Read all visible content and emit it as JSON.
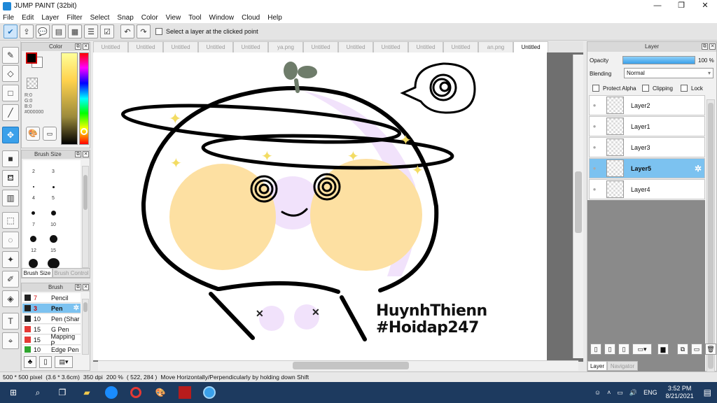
{
  "window": {
    "title": "JUMP PAINT (32bit)"
  },
  "menu": [
    "File",
    "Edit",
    "Layer",
    "Filter",
    "Select",
    "Snap",
    "Color",
    "View",
    "Tool",
    "Window",
    "Cloud",
    "Help"
  ],
  "toolbar": {
    "select_layer_label": "Select a layer at the clicked point"
  },
  "tabs": [
    "Untitled",
    "Untitled",
    "Untitled",
    "Untitled",
    "Untitled",
    "ya.png",
    "Untitled",
    "Untitled",
    "Untitled",
    "Untitled",
    "Untitled",
    "an.png",
    "Untitled"
  ],
  "color_panel": {
    "title": "Color",
    "r": "R:0",
    "g": "G:0",
    "b": "B:0",
    "hex": "#000000",
    "main_color": "#000000",
    "sub_color": "#ffffff"
  },
  "brush_size_panel": {
    "title": "Brush Size",
    "labels": [
      "2",
      "3",
      "4",
      "5",
      "7",
      "10",
      "12",
      "15"
    ],
    "tabs": [
      "Brush Size",
      "Brush Control"
    ]
  },
  "brush_panel": {
    "title": "Brush",
    "items": [
      {
        "size": "7",
        "name": "Pencil",
        "color": "#222222"
      },
      {
        "size": "3",
        "name": "Pen",
        "color": "#222222"
      },
      {
        "size": "10",
        "name": "Pen (Shar",
        "color": "#222222"
      },
      {
        "size": "15",
        "name": "G Pen",
        "color": "#e53935"
      },
      {
        "size": "15",
        "name": "Mapping P",
        "color": "#e53935"
      },
      {
        "size": "10",
        "name": "Edge Pen",
        "color": "#2fa52f"
      }
    ]
  },
  "canvas": {
    "watermark_line1": "HuynhThienn",
    "watermark_line2": "#Hoidap247"
  },
  "layer_panel": {
    "title": "Layer",
    "opacity_label": "Opacity",
    "opacity_value": "100 %",
    "opacity_fraction": 1.0,
    "blending_label": "Blending",
    "blending_value": "Normal",
    "protect_alpha": "Protect Alpha",
    "clipping": "Clipping",
    "lock": "Lock",
    "layers": [
      "Layer2",
      "Layer1",
      "Layer3",
      "Layer5",
      "Layer4"
    ],
    "tabs": [
      "Layer",
      "Navigator"
    ]
  },
  "status": {
    "size": "500 * 500 pixel",
    "cm": "(3.6 * 3.6cm)",
    "dpi": "350 dpi",
    "zoom": "200 %",
    "coords": "( 522, 284 )",
    "hint": "Move Horizontally/Perpendicularly by holding down Shift"
  },
  "taskbar": {
    "lang": "ENG",
    "time": "3:52 PM",
    "date": "8/21/2021"
  },
  "colors": {
    "accent": "#3aa0ea",
    "selected_row": "#7cc2f0",
    "taskbar": "#1d3a5f"
  }
}
